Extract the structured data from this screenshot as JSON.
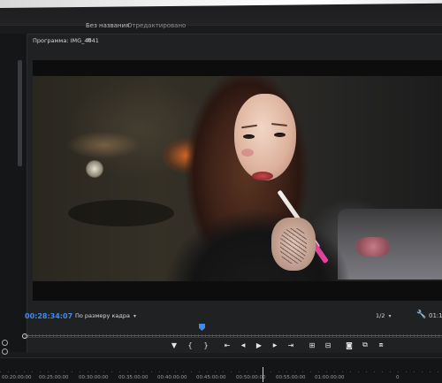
{
  "window": {
    "title": "Без названия",
    "separator": "-",
    "status": "Отредактировано"
  },
  "program_panel": {
    "title": "Программа: IMG_4041",
    "menu_icon": "hamburger-icon"
  },
  "playback": {
    "timecode": "00:28:34:07",
    "fit": "По размеру кадра",
    "resolution": "1/2",
    "duration": "01:1"
  },
  "controls": [
    {
      "name": "add-marker-button",
      "icon": "marker-icon",
      "glyph": "▼"
    },
    {
      "name": "mark-in-button",
      "icon": "bracket-left-icon",
      "glyph": "{"
    },
    {
      "name": "mark-out-button",
      "icon": "bracket-right-icon",
      "glyph": "}"
    },
    {
      "name": "go-to-in-button",
      "icon": "go-to-in-icon",
      "glyph": "⇤"
    },
    {
      "name": "step-back-button",
      "icon": "step-back-icon",
      "glyph": "◀"
    },
    {
      "name": "play-button",
      "icon": "play-icon",
      "glyph": "▶"
    },
    {
      "name": "step-forward-button",
      "icon": "step-forward-icon",
      "glyph": "▶"
    },
    {
      "name": "go-to-out-button",
      "icon": "go-to-out-icon",
      "glyph": "⇥"
    },
    {
      "name": "insert-button",
      "icon": "insert-icon",
      "glyph": "⊞"
    },
    {
      "name": "overwrite-button",
      "icon": "overwrite-icon",
      "glyph": "⊟"
    },
    {
      "name": "export-frame-button",
      "icon": "camera-icon",
      "glyph": "◙"
    },
    {
      "name": "comparison-view-button",
      "icon": "comparison-icon",
      "glyph": "⧉"
    },
    {
      "name": "proxy-toggle-button",
      "icon": "proxy-icon",
      "glyph": "⧈"
    }
  ],
  "ruler": {
    "ticks": [
      "00:20:00:00",
      "00:25:00:00",
      "00:30:00:00",
      "00:35:00:00",
      "00:40:00:00",
      "00:45:00:00",
      "00:50:00:00",
      "00:55:00:00",
      "01:00:00:00",
      "0"
    ]
  },
  "colors": {
    "accent": "#3d8cf0",
    "panel": "#202123",
    "background": "#1a1b1d"
  }
}
